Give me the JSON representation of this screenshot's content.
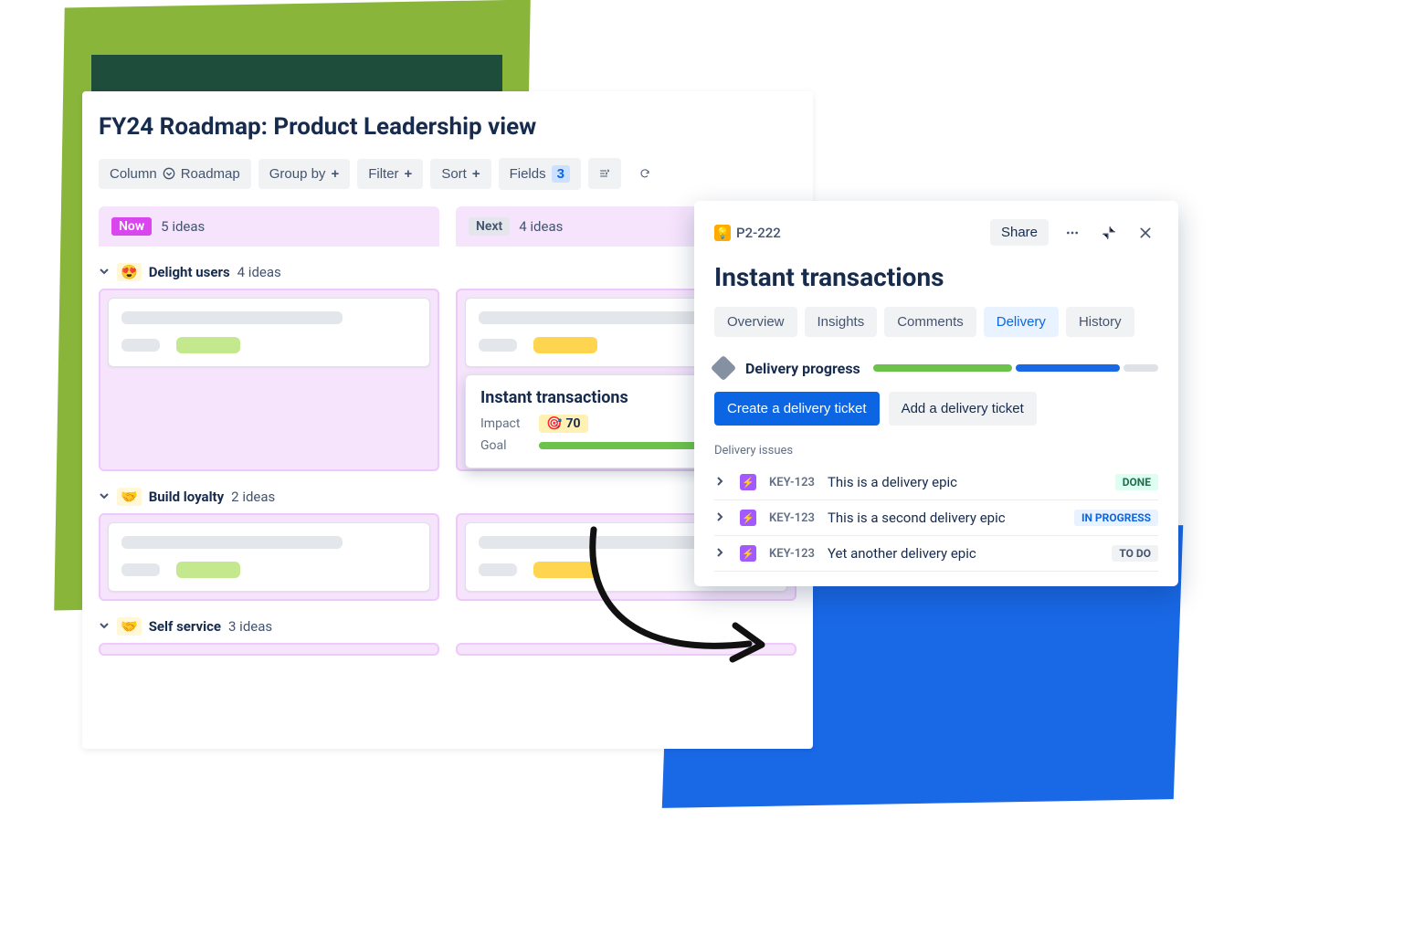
{
  "board": {
    "title": "FY24 Roadmap: Product Leadership view",
    "toolbar": {
      "column_label": "Column",
      "column_value": "Roadmap",
      "group_by": "Group by",
      "filter": "Filter",
      "sort": "Sort",
      "fields": "Fields",
      "fields_count": "3"
    },
    "columns": [
      {
        "tag": "Now",
        "count": "5 ideas"
      },
      {
        "tag": "Next",
        "count": "4 ideas"
      }
    ],
    "groups": [
      {
        "emoji": "😍",
        "name": "Delight users",
        "count": "4 ideas"
      },
      {
        "emoji": "🤝",
        "name": "Build loyalty",
        "count": "2 ideas"
      },
      {
        "emoji": "🤝",
        "name": "Self service",
        "count": "3 ideas"
      }
    ],
    "featured_card": {
      "title": "Instant transactions",
      "impact_label": "Impact",
      "impact_value": "70",
      "goal_label": "Goal"
    }
  },
  "panel": {
    "issue_key": "P2-222",
    "share": "Share",
    "title": "Instant transactions",
    "tabs": {
      "overview": "Overview",
      "insights": "Insights",
      "comments": "Comments",
      "delivery": "Delivery",
      "history": "History"
    },
    "delivery_progress_label": "Delivery progress",
    "create_btn": "Create a delivery ticket",
    "add_btn": "Add a delivery ticket",
    "issues_label": "Delivery issues",
    "issues": [
      {
        "key": "KEY-123",
        "summary": "This is a delivery epic",
        "status": "DONE",
        "status_class": "lz-done"
      },
      {
        "key": "KEY-123",
        "summary": "This is a second delivery epic",
        "status": "IN PROGRESS",
        "status_class": "lz-prog"
      },
      {
        "key": "KEY-123",
        "summary": "Yet another delivery epic",
        "status": "TO DO",
        "status_class": "lz-todo"
      }
    ]
  }
}
